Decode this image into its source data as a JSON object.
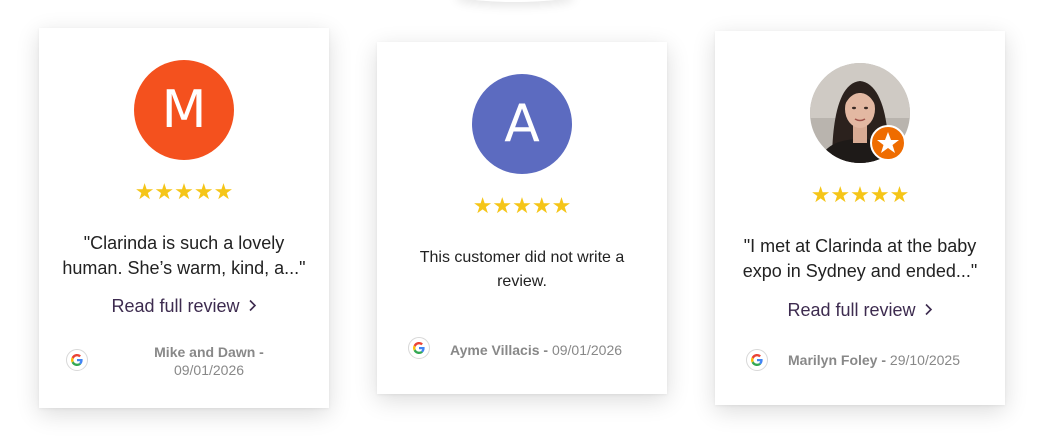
{
  "reviews": [
    {
      "initial": "M",
      "avatar_color": "#f4511e",
      "stars": "★★★★★",
      "text": "\"Clarinda is such a lovely human. She’s warm, kind, a...\"",
      "read_more": "Read full review",
      "reviewer": "Mike and Dawn",
      "separator": "-",
      "date": "09/01/2026",
      "source_icon": "google-icon"
    },
    {
      "initial": "A",
      "avatar_color": "#5c6bc0",
      "stars": "★★★★★",
      "text": "This customer did not write a review.",
      "reviewer": "Ayme Villacis",
      "separator": "-",
      "date": "09/01/2026",
      "source_icon": "google-icon"
    },
    {
      "avatar": "photo",
      "badge_icon": "star-badge-icon",
      "badge_color": "#ef6c00",
      "stars": "★★★★★",
      "text": "\"I met at Clarinda at the baby expo in Sydney and ended...\"",
      "read_more": "Read full review",
      "reviewer": "Marilyn Foley",
      "separator": "-",
      "date": "29/10/2025",
      "source_icon": "google-icon"
    }
  ],
  "colors": {
    "star": "#f5c518",
    "link": "#3d2b4f",
    "meta": "#888888"
  }
}
